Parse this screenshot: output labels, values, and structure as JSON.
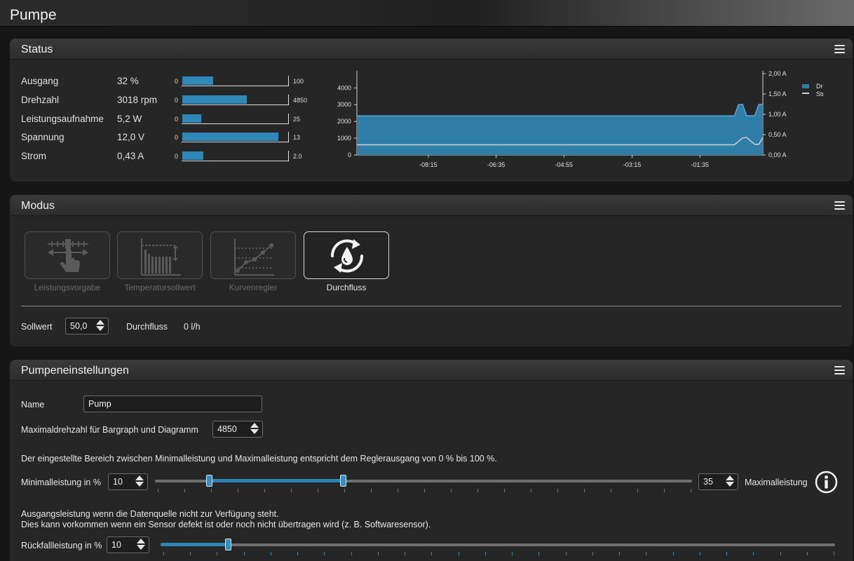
{
  "window": {
    "title": "Pumpe"
  },
  "status": {
    "title": "Status",
    "rows": [
      {
        "label": "Ausgang",
        "value": "32 %",
        "min": "0",
        "max": "100",
        "fraction": 0.29
      },
      {
        "label": "Drehzahl",
        "value": "3018 rpm",
        "min": "0",
        "max": "4850",
        "fraction": 0.61
      },
      {
        "label": "Leistungsaufnahme",
        "value": "5,2 W",
        "min": "0",
        "max": "25",
        "fraction": 0.18
      },
      {
        "label": "Spannung",
        "value": "12,0 V",
        "min": "0",
        "max": "13",
        "fraction": 0.91
      },
      {
        "label": "Strom",
        "value": "0,43 A",
        "min": "0",
        "max": "2.0",
        "fraction": 0.2
      }
    ]
  },
  "chart_data": {
    "type": "area",
    "x_ticks": [
      "-08:15",
      "-06:35",
      "-04:55",
      "-03:15",
      "-01:35"
    ],
    "y_ticks_left": [
      "4000",
      "3000",
      "2000",
      "1000",
      "0"
    ],
    "y_ticks_right": [
      "2,00 A",
      "1,50 A",
      "1,00 A",
      "0,50 A",
      "0,00 A"
    ],
    "ylim_left": [
      0,
      4850
    ],
    "ylim_right": [
      0,
      2.0
    ],
    "legend": [
      "Drehzahl",
      "Strom"
    ],
    "legend_placement": "top-right",
    "colors": {
      "drehzahl": "#2f7ea8",
      "drehzahl_line": "#5aa7d6",
      "strom": "#cfcfcf"
    },
    "series": [
      {
        "name": "Drehzahl",
        "x": [
          0,
          0.92,
          0.93,
          0.94,
          0.95,
          0.96,
          0.98,
          0.99,
          1.0
        ],
        "values": [
          2330,
          2330,
          2330,
          3000,
          3020,
          2340,
          2340,
          3010,
          3018
        ]
      },
      {
        "name": "Strom",
        "x": [
          0,
          0.92,
          0.93,
          0.95,
          0.96,
          0.98,
          0.99,
          1.0
        ],
        "values": [
          0.25,
          0.25,
          0.25,
          0.42,
          0.43,
          0.26,
          0.26,
          0.43
        ]
      }
    ]
  },
  "modus": {
    "title": "Modus",
    "modes": [
      {
        "label": "Leistungsvorgabe",
        "icon": "manual-slider-icon",
        "active": false
      },
      {
        "label": "Temperatursollwert",
        "icon": "temperature-setpoint-icon",
        "active": false
      },
      {
        "label": "Kurvenregler",
        "icon": "curve-controller-icon",
        "active": false
      },
      {
        "label": "Durchfluss",
        "icon": "flow-cycle-icon",
        "active": true
      }
    ],
    "sollwert_label": "Sollwert",
    "sollwert_value": "50,0",
    "durchfluss_label": "Durchfluss",
    "durchfluss_value": "0 l/h"
  },
  "pumpe": {
    "title": "Pumpeneinstellungen",
    "name_label": "Name",
    "name_value": "Pump",
    "maxrpm_label": "Maximaldrehzahl für Bargraph und Diagramm",
    "maxrpm_value": "4850",
    "range_info": "Der eingestellte Bereich zwischen Minimalleistung und Maximalleistung entspricht dem Reglerausgang von 0 % bis 100 %.",
    "min_label": "Minimalleistung in %",
    "min_value": "10",
    "max_value": "35",
    "max_label": "Maximalleistung",
    "min_pct": 10,
    "max_pct": 35,
    "fallback_info_1": "Ausgangsleistung wenn die Datenquelle nicht zur Verfügung steht.",
    "fallback_info_2": "Dies kann vorkommen wenn ein Sensor defekt ist oder noch nicht übertragen wird (z. B. Softwaresensor).",
    "fallback_label": "Rückfallleistung in %",
    "fallback_value": "10",
    "fallback_pct": 10
  }
}
